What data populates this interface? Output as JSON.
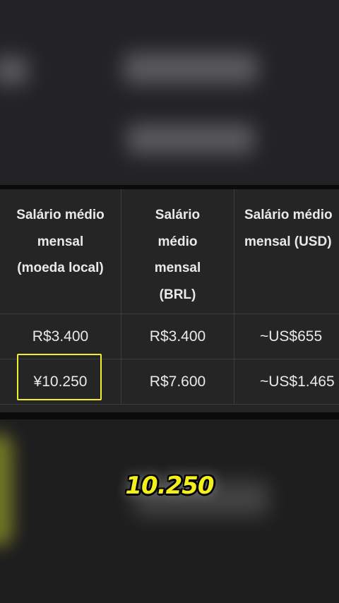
{
  "table": {
    "headers": [
      "Salário médio\nmensal\n(moeda local)",
      "Salário\nmédio\nmensal\n(BRL)",
      "Salário médio\nmensal (USD)"
    ],
    "rows": [
      [
        "R$3.400",
        "R$3.400",
        "~US$655"
      ],
      [
        "¥10.250",
        "R$7.600",
        "~US$1.465"
      ]
    ]
  },
  "overlay": {
    "highlight_color": "#f1ee2e",
    "caption": "10.250",
    "caption_color": "#f4ee1c"
  }
}
